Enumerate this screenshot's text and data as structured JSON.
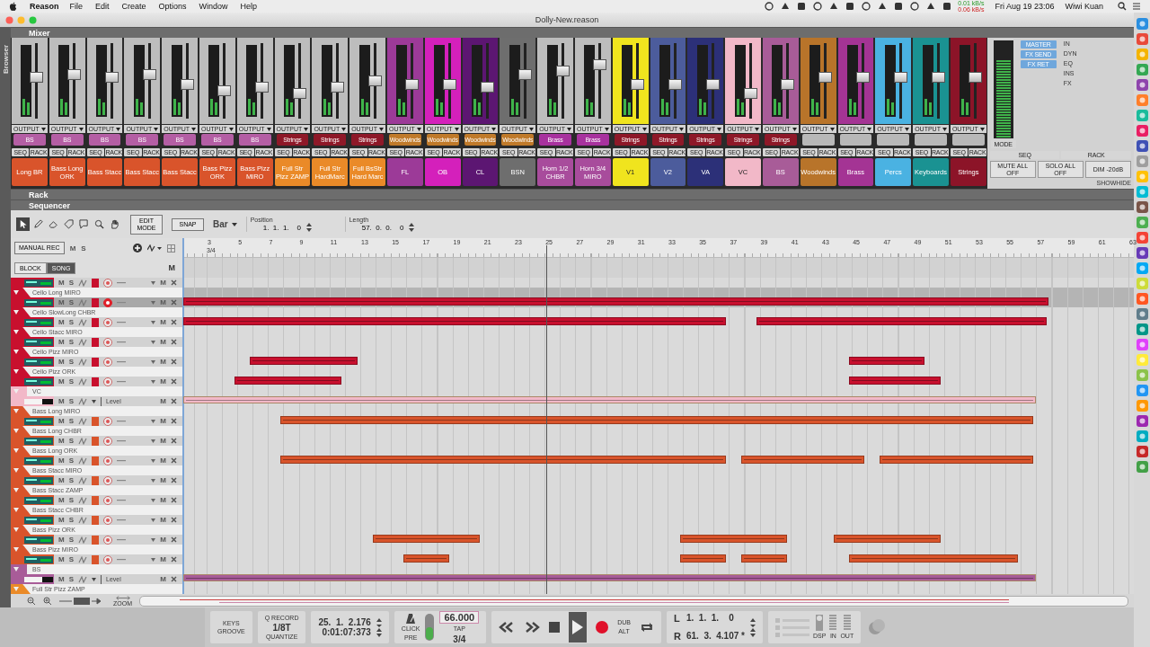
{
  "menu_bar": {
    "app": "Reason",
    "menus": [
      "File",
      "Edit",
      "Create",
      "Options",
      "Window",
      "Help"
    ],
    "net_up": "0.01 kB/s",
    "net_down": "0.06 kB/s",
    "clock": "Fri Aug 19  23:06",
    "user": "Wiwi Kuan"
  },
  "window": {
    "title": "Dolly-New.reason"
  },
  "browser": {
    "label": "Browser"
  },
  "mixer": {
    "title": "Mixer",
    "channels": [
      {
        "name": "Long BR",
        "color": "#d9542b",
        "output": {
          "label": "BS",
          "color": "#b45ea4"
        },
        "output_header": "OUTPUT",
        "seq": "SEQ",
        "rack": "RACK",
        "tinted": false,
        "level": 0.55
      },
      {
        "name": "Bass Long ORK",
        "color": "#d9542b",
        "output": {
          "label": "BS",
          "color": "#b45ea4"
        },
        "output_header": "OUTPUT",
        "seq": "SEQ",
        "rack": "RACK",
        "tinted": false,
        "level": 0.6
      },
      {
        "name": "Bass Stacc",
        "color": "#d9542b",
        "output": {
          "label": "BS",
          "color": "#b45ea4"
        },
        "output_header": "OUTPUT",
        "seq": "SEQ",
        "rack": "RACK",
        "tinted": false,
        "level": 0.55
      },
      {
        "name": "Bass Stacc",
        "color": "#d9542b",
        "output": {
          "label": "BS",
          "color": "#b45ea4"
        },
        "output_header": "OUTPUT",
        "seq": "SEQ",
        "rack": "RACK",
        "tinted": false,
        "level": 0.6
      },
      {
        "name": "Bass Stacc",
        "color": "#d9542b",
        "output": {
          "label": "BS",
          "color": "#b45ea4"
        },
        "output_header": "OUTPUT",
        "seq": "SEQ",
        "rack": "RACK",
        "tinted": false,
        "level": 0.45
      },
      {
        "name": "Bass Pizz ORK",
        "color": "#d9542b",
        "output": {
          "label": "BS",
          "color": "#b45ea4"
        },
        "output_header": "OUTPUT",
        "seq": "SEQ",
        "rack": "RACK",
        "tinted": false,
        "level": 0.35
      },
      {
        "name": "Bass Pizz MIRO",
        "color": "#d9542b",
        "output": {
          "label": "BS",
          "color": "#b45ea4"
        },
        "output_header": "OUTPUT",
        "seq": "SEQ",
        "rack": "RACK",
        "tinted": false,
        "level": 0.4
      },
      {
        "name": "Full Str Pizz ZAMP",
        "color": "#ea8a28",
        "output": {
          "label": "Strings",
          "color": "#8e1828"
        },
        "output_header": "OUTPUT",
        "seq": "SEQ",
        "rack": "RACK",
        "tinted": false,
        "level": 0.3
      },
      {
        "name": "Full Str HardMarc",
        "color": "#ea8a28",
        "output": {
          "label": "Strings",
          "color": "#8e1828"
        },
        "output_header": "OUTPUT",
        "seq": "SEQ",
        "rack": "RACK",
        "tinted": false,
        "level": 0.4
      },
      {
        "name": "Full BsStr Hard Marc",
        "color": "#ea8a28",
        "output": {
          "label": "Strings",
          "color": "#8e1828"
        },
        "output_header": "OUTPUT",
        "seq": "SEQ",
        "rack": "RACK",
        "tinted": false,
        "level": 0.5
      },
      {
        "name": "FL",
        "color": "#9c3a98",
        "output": {
          "label": "Woodwinds",
          "color": "#c07a2a"
        },
        "output_header": "OUTPUT",
        "seq": "SEQ",
        "rack": "RACK",
        "tinted": true,
        "level": 0.45
      },
      {
        "name": "OB",
        "color": "#d420bb",
        "output": {
          "label": "Woodwinds",
          "color": "#c07a2a"
        },
        "output_header": "OUTPUT",
        "seq": "SEQ",
        "rack": "RACK",
        "tinted": true,
        "level": 0.45
      },
      {
        "name": "CL",
        "color": "#5c1672",
        "output": {
          "label": "Woodwinds",
          "color": "#c07a2a"
        },
        "output_header": "OUTPUT",
        "seq": "SEQ",
        "rack": "RACK",
        "tinted": true,
        "level": 0.4
      },
      {
        "name": "BSN",
        "color": "#6e6e6e",
        "output": {
          "label": "Woodwinds",
          "color": "#c07a2a"
        },
        "output_header": "OUTPUT",
        "seq": "SEQ",
        "rack": "RACK",
        "tinted": true,
        "level": 0.6
      },
      {
        "name": "Horn 1/2 CHBR",
        "color": "#a84c9c",
        "output": {
          "label": "Brass",
          "color": "#a8329e"
        },
        "output_header": "OUTPUT",
        "seq": "SEQ",
        "rack": "RACK",
        "tinted": false,
        "level": 0.65
      },
      {
        "name": "Horn 3/4 MIRO",
        "color": "#a84c9c",
        "output": {
          "label": "Brass",
          "color": "#a8329e"
        },
        "output_header": "OUTPUT",
        "seq": "SEQ",
        "rack": "RACK",
        "tinted": false,
        "level": 0.75
      },
      {
        "name": "V1",
        "color": "#f0e41e",
        "output": {
          "label": "Strings",
          "color": "#8e1828"
        },
        "output_header": "OUTPUT",
        "seq": "SEQ",
        "rack": "RACK",
        "tinted": true,
        "level": 0.45
      },
      {
        "name": "V2",
        "color": "#4c5c9c",
        "output": {
          "label": "Strings",
          "color": "#8e1828"
        },
        "output_header": "OUTPUT",
        "seq": "SEQ",
        "rack": "RACK",
        "tinted": true,
        "level": 0.45
      },
      {
        "name": "VA",
        "color": "#2c3078",
        "output": {
          "label": "Strings",
          "color": "#8e1828"
        },
        "output_header": "OUTPUT",
        "seq": "SEQ",
        "rack": "RACK",
        "tinted": true,
        "level": 0.45
      },
      {
        "name": "VC",
        "color": "#f2b8c8",
        "output": {
          "label": "Strings",
          "color": "#8e1828"
        },
        "output_header": "OUTPUT",
        "seq": "SEQ",
        "rack": "RACK",
        "tinted": true,
        "level": 0.3
      },
      {
        "name": "BS",
        "color": "#a85c98",
        "output": {
          "label": "Strings",
          "color": "#8e1828"
        },
        "output_header": "OUTPUT",
        "seq": "SEQ",
        "rack": "RACK",
        "tinted": true,
        "level": 0.45
      },
      {
        "name": "Woodwinds",
        "color": "#b8742a",
        "output_header": "OUTPUT",
        "seq": "SEQ",
        "rack": "RACK",
        "tinted": true,
        "level": 0.55
      },
      {
        "name": "Brass",
        "color": "#a43494",
        "output_header": "OUTPUT",
        "seq": "SEQ",
        "rack": "RACK",
        "tinted": true,
        "level": 0.55
      },
      {
        "name": "Percs",
        "color": "#4ab2e2",
        "output_header": "OUTPUT",
        "seq": "SEQ",
        "rack": "RACK",
        "tinted": true,
        "level": 0.55
      },
      {
        "name": "Keyboards",
        "color": "#1a9292",
        "output_header": "OUTPUT",
        "seq": "SEQ",
        "rack": "RACK",
        "tinted": true,
        "level": 0.55
      },
      {
        "name": "Strings",
        "color": "#8c1428",
        "output_header": "OUTPUT",
        "seq": "SEQ",
        "rack": "RACK",
        "tinted": true,
        "level": 0.55
      }
    ],
    "master": {
      "mode": "MODE",
      "sends": [
        "MASTER",
        "FX SEND",
        "FX RET"
      ],
      "sections": [
        "IN",
        "DYN",
        "EQ",
        "INS",
        "FX"
      ],
      "seq": "SEQ",
      "rack": "RACK",
      "buttons": [
        "MUTE ALL OFF",
        "SOLO ALL OFF",
        "DIM -20dB"
      ],
      "showhide": "SHOWHIDE",
      "level": 0.8
    }
  },
  "rack": {
    "title": "Rack"
  },
  "sequencer": {
    "title": "Sequencer",
    "tools": [
      {
        "kind": "select",
        "selected": true
      },
      {
        "kind": "pencil",
        "selected": false
      },
      {
        "kind": "eraser",
        "selected": false
      },
      {
        "kind": "tag",
        "selected": false
      },
      {
        "kind": "speech",
        "selected": false
      },
      {
        "kind": "magnifier",
        "selected": false
      },
      {
        "kind": "hand",
        "selected": false
      }
    ],
    "edit_mode": "EDIT MODE",
    "snap": "SNAP",
    "snap_value": "Bar",
    "position_label": "Position",
    "position": "1.  1.  1.    0",
    "length_label": "Length",
    "length": "57.  0.  0.    0",
    "manual_rec": "MANUAL REC",
    "mute_all": "M",
    "solo_all": "S",
    "modes": [
      {
        "label": "BLOCK",
        "selected": false
      },
      {
        "label": "SONG",
        "selected": true
      }
    ],
    "song_mute": "M",
    "ruler": {
      "bars": [
        "3",
        "5",
        "7",
        "9",
        "11",
        "13",
        "15",
        "17",
        "19",
        "21",
        "23",
        "25",
        "27",
        "29",
        "31",
        "33",
        "35",
        "37",
        "39",
        "41",
        "43",
        "45",
        "47",
        "49",
        "51",
        "53",
        "55",
        "57",
        "59",
        "61",
        "63"
      ],
      "signature": "3/4"
    },
    "tracks": [
      {
        "kind": "instrument",
        "name_visible": false,
        "color": "#c8102e",
        "mute": "M",
        "solo": "S",
        "lane_mute": "M",
        "selected": false,
        "armed": false
      },
      {
        "kind": "instrument",
        "name": "Cello Long MIRO",
        "color": "#c8102e",
        "mute": "M",
        "solo": "S",
        "lane_mute": "M",
        "selected": true,
        "armed": true
      },
      {
        "kind": "instrument",
        "name": "Cello SlowLong CHBR",
        "color": "#c8102e",
        "mute": "M",
        "solo": "S",
        "lane_mute": "M",
        "selected": false,
        "armed": false
      },
      {
        "kind": "instrument",
        "name": "Cello Stacc MIRO",
        "color": "#c8102e",
        "mute": "M",
        "solo": "S",
        "lane_mute": "M",
        "selected": false,
        "armed": false
      },
      {
        "kind": "instrument",
        "name": "Cello Pizz MIRO",
        "color": "#c8102e",
        "mute": "M",
        "solo": "S",
        "lane_mute": "M",
        "selected": false,
        "armed": false
      },
      {
        "kind": "instrument",
        "name": "Cello Pizz ORK",
        "color": "#c8102e",
        "mute": "M",
        "solo": "S",
        "lane_mute": "M",
        "selected": false,
        "armed": false
      },
      {
        "kind": "level",
        "name": "VC",
        "color": "#f2b8c8",
        "mute": "M",
        "solo": "S",
        "lane_mute": "M",
        "level_label": "Level",
        "selected": false
      },
      {
        "kind": "instrument",
        "name": "Bass Long MIRO",
        "color": "#d9542b",
        "mute": "M",
        "solo": "S",
        "lane_mute": "M",
        "selected": false,
        "armed": false
      },
      {
        "kind": "instrument",
        "name": "Bass Long CHBR",
        "color": "#d9542b",
        "mute": "M",
        "solo": "S",
        "lane_mute": "M",
        "selected": false,
        "armed": false
      },
      {
        "kind": "instrument",
        "name": "Bass Long ORK",
        "color": "#d9542b",
        "mute": "M",
        "solo": "S",
        "lane_mute": "M",
        "selected": false,
        "armed": false
      },
      {
        "kind": "instrument",
        "name": "Bass Stacc MIRO",
        "color": "#d9542b",
        "mute": "M",
        "solo": "S",
        "lane_mute": "M",
        "selected": false,
        "armed": false
      },
      {
        "kind": "instrument",
        "name": "Bass Stacc ZAMP",
        "color": "#d9542b",
        "mute": "M",
        "solo": "S",
        "lane_mute": "M",
        "selected": false,
        "armed": false
      },
      {
        "kind": "instrument",
        "name": "Bass Stacc CHBR",
        "color": "#d9542b",
        "mute": "M",
        "solo": "S",
        "lane_mute": "M",
        "selected": false,
        "armed": false
      },
      {
        "kind": "instrument",
        "name": "Bass Pizz ORK",
        "color": "#d9542b",
        "mute": "M",
        "solo": "S",
        "lane_mute": "M",
        "selected": false,
        "armed": false
      },
      {
        "kind": "instrument",
        "name": "Bass Pizz MIRO",
        "color": "#d9542b",
        "mute": "M",
        "solo": "S",
        "lane_mute": "M",
        "selected": false,
        "armed": false
      },
      {
        "kind": "level",
        "name": "BS",
        "color": "#a85c98",
        "mute": "M",
        "solo": "S",
        "lane_mute": "M",
        "level_label": "Level",
        "selected": false
      },
      {
        "kind": "instrument",
        "name": "Full Str Pizz ZAMP",
        "color": "#ea8a28",
        "selected": false
      }
    ],
    "zoom_label": "ZOOM"
  },
  "transport": {
    "keys": "KEYS",
    "groove": "GROOVE",
    "q_record": "Q RECORD",
    "quantize_value": "1/8T",
    "quantize": "QUANTIZE",
    "position": "25.  1.  2.176",
    "time": "0:01:07:373",
    "click": "CLICK",
    "pre": "PRE",
    "tempo": "66.000",
    "tap": "TAP",
    "signature": "3/4",
    "dub": "DUB",
    "alt": "ALT",
    "playing": true,
    "left_label": "L",
    "left": "1.  1.  1.    0",
    "right_label": "R",
    "right": "61.  3.  4.107 *",
    "dsp": "DSP",
    "in": "IN",
    "out": "OUT"
  }
}
